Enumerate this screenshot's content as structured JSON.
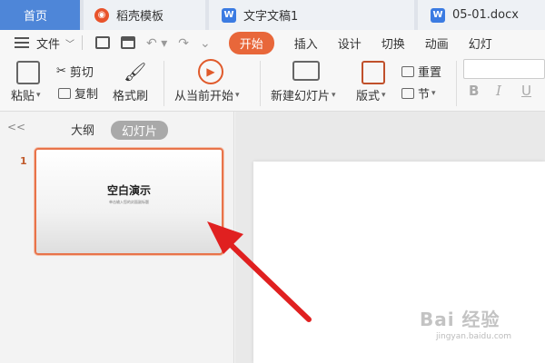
{
  "tabs": {
    "home": "首页",
    "templates": "稻壳模板",
    "doc1": "文字文稿1",
    "doc2": "05-01.docx"
  },
  "menu": {
    "file": "文件",
    "items": [
      "开始",
      "插入",
      "设计",
      "切换",
      "动画",
      "幻灯"
    ]
  },
  "ribbon": {
    "paste": "粘贴",
    "cut": "剪切",
    "copy": "复制",
    "format_painter": "格式刷",
    "from_current": "从当前开始",
    "new_slide": "新建幻灯片",
    "layout": "版式",
    "reset": "重置",
    "section": "节",
    "bold": "B",
    "italic": "I",
    "underline": "U"
  },
  "left_panel": {
    "outline_tab": "大纲",
    "slides_tab": "幻灯片",
    "slide_number": "1",
    "thumb_title": "空白演示",
    "thumb_subtitle": "单击输入您的封面副标题"
  },
  "watermark": {
    "main": "Bai 经验",
    "sub": "jingyan.baidu.com"
  },
  "colors": {
    "accent": "#e8673a",
    "home_tab": "#4e86d8",
    "arrow": "#e02020"
  }
}
